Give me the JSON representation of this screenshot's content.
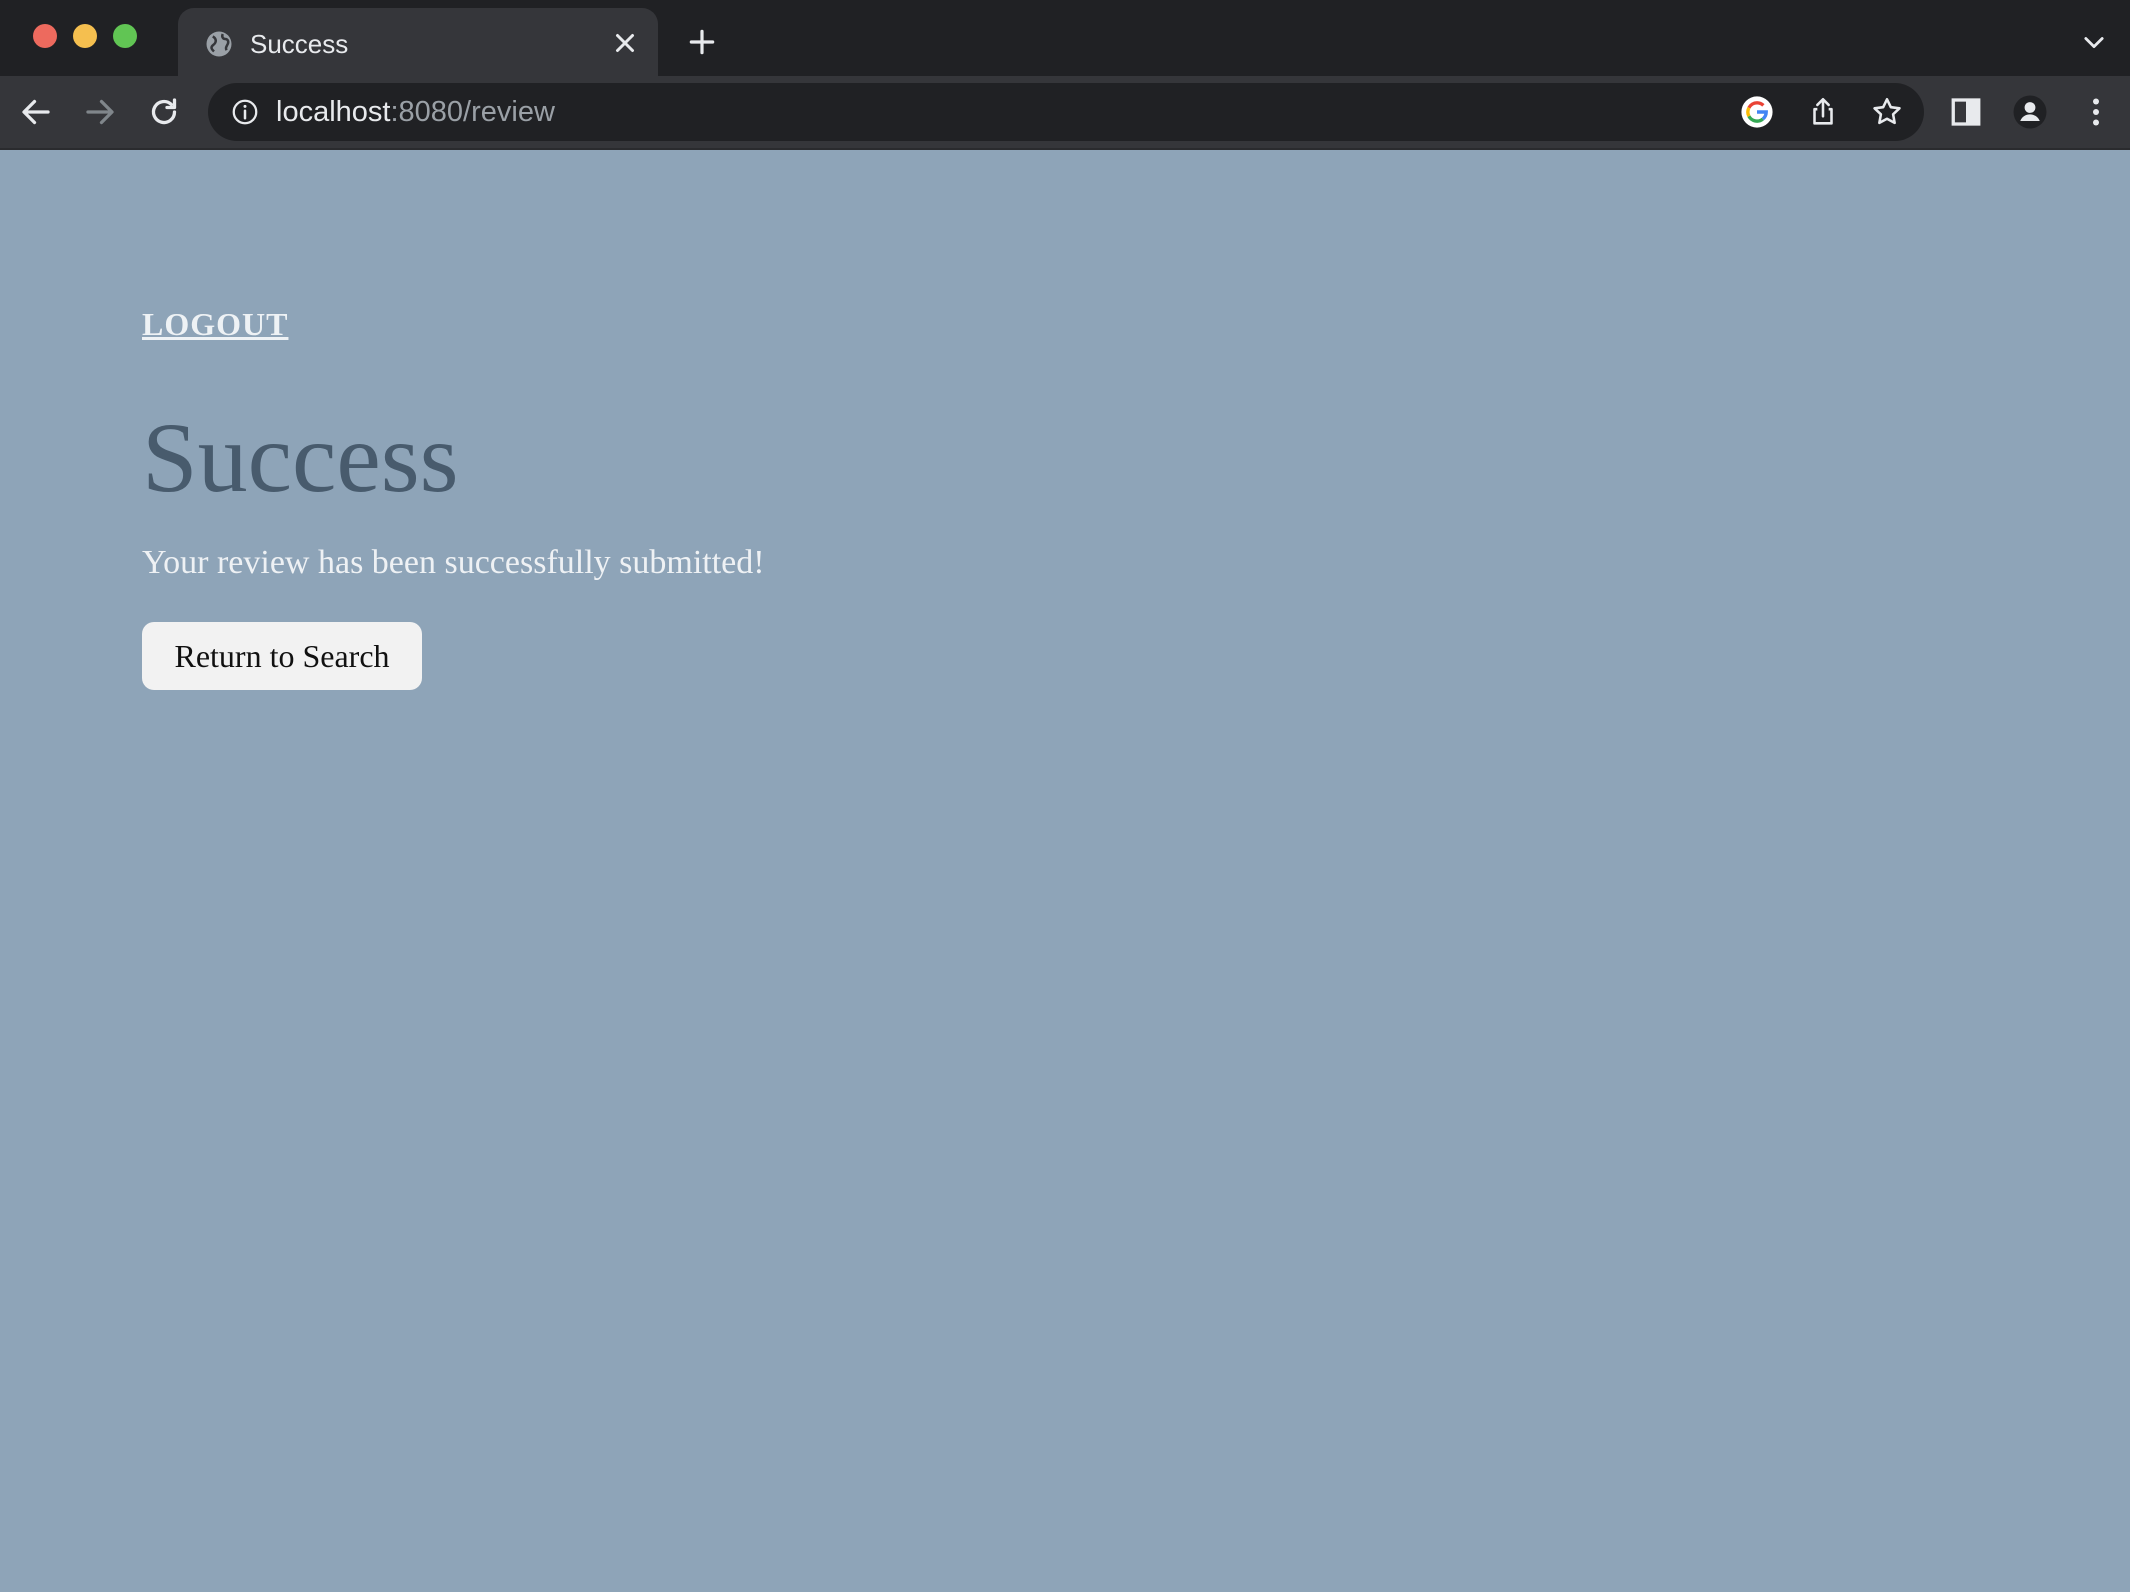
{
  "browser": {
    "tab": {
      "title": "Success",
      "favicon_icon": "globe-icon",
      "close_icon": "close-icon"
    },
    "new_tab_icon": "plus-icon",
    "tab_search_icon": "chevron-down-icon",
    "toolbar": {
      "back_icon": "arrow-left-icon",
      "forward_icon": "arrow-right-icon",
      "reload_icon": "reload-icon",
      "site_info_icon": "info-icon",
      "url_host": "localhost",
      "url_rest": ":8080/review",
      "google_icon": "google-icon",
      "share_icon": "share-icon",
      "bookmark_icon": "star-icon",
      "side_panel_icon": "side-panel-icon",
      "profile_icon": "profile-icon",
      "menu_icon": "kebab-menu-icon"
    }
  },
  "page": {
    "logout_label": "LOGOUT",
    "title": "Success",
    "message": "Your review has been successfully submitted!",
    "return_button_label": "Return to Search"
  },
  "colors": {
    "page_background": "#8ea4b8",
    "title_text": "#485b6d",
    "message_text": "#eef1f4",
    "button_background": "#f2f2f2",
    "chrome_dark": "#202124",
    "chrome_toolbar": "#35363a"
  }
}
